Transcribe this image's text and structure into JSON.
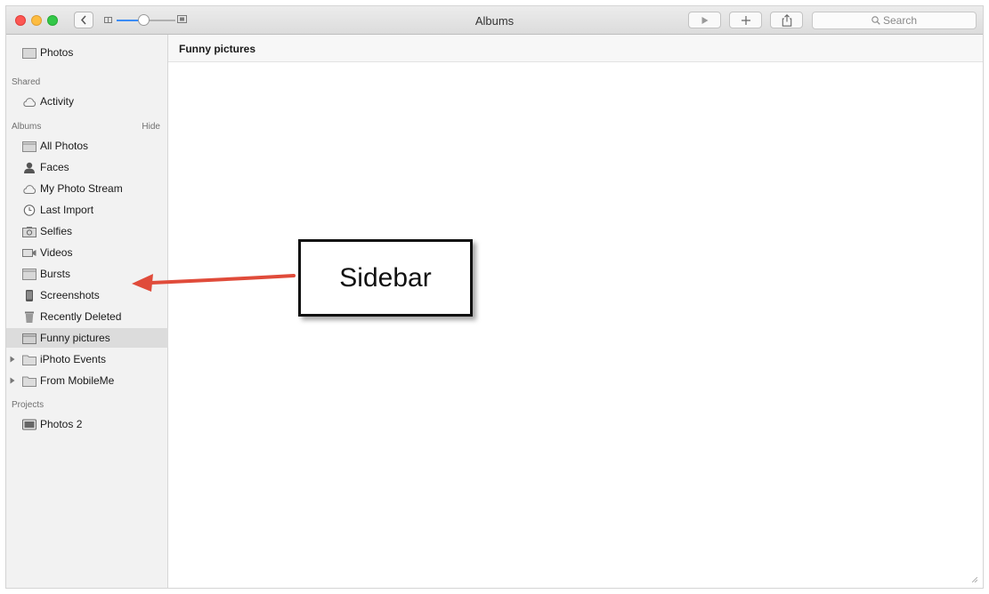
{
  "window": {
    "title": "Albums"
  },
  "toolbar": {
    "zoom_level": 0.45,
    "search_placeholder": "Search",
    "buttons": [
      "play-icon",
      "plus-icon",
      "share-icon"
    ]
  },
  "sidebar": {
    "top_item": {
      "label": "Photos",
      "icon": "photos-icon"
    },
    "shared": {
      "heading": "Shared",
      "items": [
        {
          "label": "Activity",
          "icon": "cloud-icon"
        }
      ]
    },
    "albums": {
      "heading": "Albums",
      "hide_label": "Hide",
      "items": [
        {
          "label": "All Photos",
          "icon": "album-icon"
        },
        {
          "label": "Faces",
          "icon": "person-icon"
        },
        {
          "label": "My Photo Stream",
          "icon": "cloud-icon"
        },
        {
          "label": "Last Import",
          "icon": "clock-icon"
        },
        {
          "label": "Selfies",
          "icon": "camera-icon"
        },
        {
          "label": "Videos",
          "icon": "video-icon"
        },
        {
          "label": "Bursts",
          "icon": "album-icon"
        },
        {
          "label": "Screenshots",
          "icon": "phone-icon"
        },
        {
          "label": "Recently Deleted",
          "icon": "trash-icon"
        },
        {
          "label": "Funny pictures",
          "icon": "album-icon",
          "selected": true
        },
        {
          "label": "iPhoto Events",
          "icon": "folder-icon",
          "collapsed": true
        },
        {
          "label": "From MobileMe",
          "icon": "folder-icon",
          "collapsed": true
        }
      ]
    },
    "projects": {
      "heading": "Projects",
      "items": [
        {
          "label": "Photos 2",
          "icon": "book-icon"
        }
      ]
    }
  },
  "content": {
    "title": "Funny pictures"
  },
  "annotation": {
    "label": "Sidebar",
    "arrow_color": "#e04b3a"
  },
  "colors": {
    "accent": "#3b8cf5",
    "sidebar_bg": "#f2f2f2",
    "selected_bg": "#dcdcdc",
    "close": "#fc5753",
    "minimize": "#fdbc40",
    "zoom": "#33c748"
  }
}
